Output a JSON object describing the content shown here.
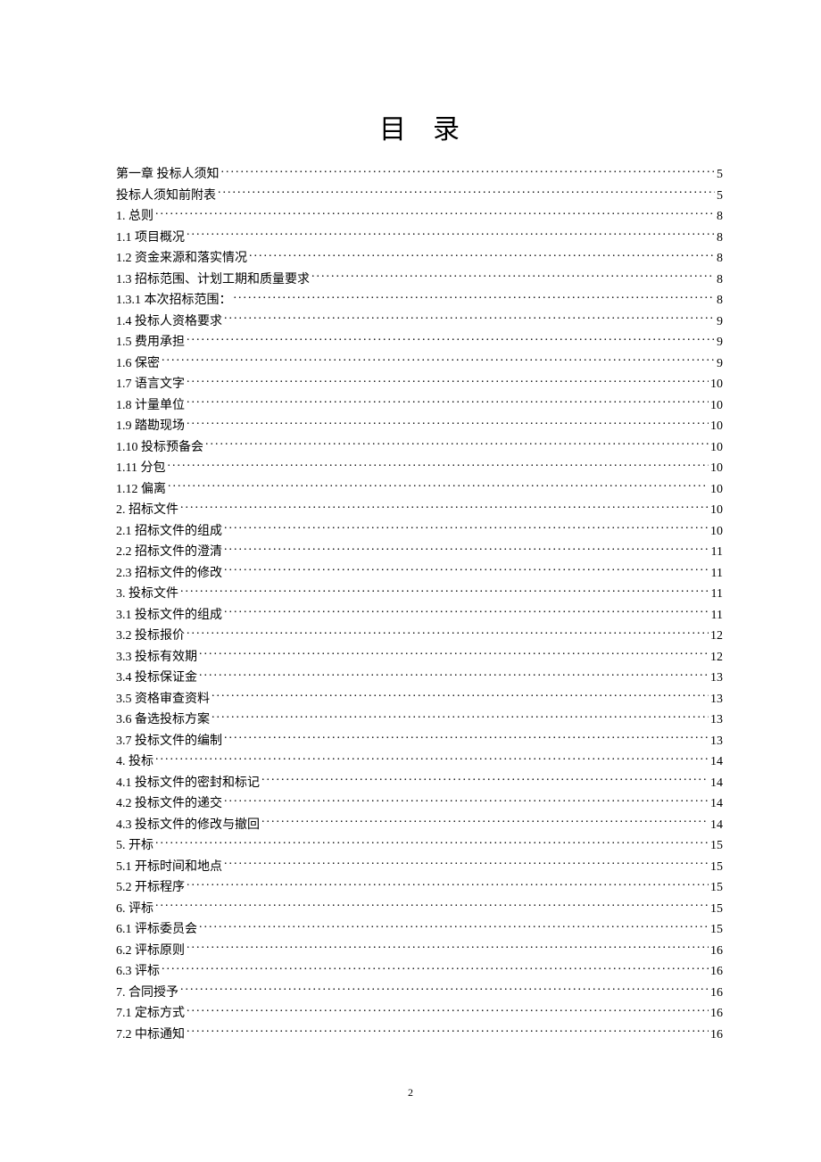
{
  "title": "目录",
  "page_number": "2",
  "toc": [
    {
      "label": "第一章   投标人须知",
      "page": "5"
    },
    {
      "label": "投标人须知前附表",
      "page": "5"
    },
    {
      "label": "1. 总则",
      "page": "8"
    },
    {
      "label": "1.1 项目概况",
      "page": "8"
    },
    {
      "label": "1.2 资金来源和落实情况",
      "page": "8"
    },
    {
      "label": "1.3 招标范围、计划工期和质量要求",
      "page": "8"
    },
    {
      "label": "1.3.1 本次招标范围：",
      "page": "8"
    },
    {
      "label": "1.4 投标人资格要求",
      "page": "9"
    },
    {
      "label": "1.5 费用承担",
      "page": "9"
    },
    {
      "label": "1.6 保密",
      "page": "9"
    },
    {
      "label": "1.7 语言文字",
      "page": "10"
    },
    {
      "label": "1.8 计量单位",
      "page": "10"
    },
    {
      "label": "1.9 踏勘现场",
      "page": "10"
    },
    {
      "label": "1.10 投标预备会",
      "page": "10"
    },
    {
      "label": "1.11 分包",
      "page": "10"
    },
    {
      "label": "1.12 偏离",
      "page": "10"
    },
    {
      "label": "2. 招标文件",
      "page": "10"
    },
    {
      "label": "2.1 招标文件的组成",
      "page": "10"
    },
    {
      "label": "2.2 招标文件的澄清",
      "page": "11"
    },
    {
      "label": "2.3 招标文件的修改",
      "page": "11"
    },
    {
      "label": "3. 投标文件",
      "page": "11"
    },
    {
      "label": "3.1 投标文件的组成",
      "page": "11"
    },
    {
      "label": "3.2 投标报价",
      "page": "12"
    },
    {
      "label": "3.3 投标有效期",
      "page": "12"
    },
    {
      "label": "3.4 投标保证金",
      "page": "13"
    },
    {
      "label": "3.5 资格审查资料",
      "page": "13"
    },
    {
      "label": "3.6 备选投标方案",
      "page": "13"
    },
    {
      "label": "3.7 投标文件的编制",
      "page": "13"
    },
    {
      "label": "4. 投标",
      "page": "14"
    },
    {
      "label": "4.1 投标文件的密封和标记",
      "page": "14"
    },
    {
      "label": "4.2 投标文件的递交",
      "page": "14"
    },
    {
      "label": "4.3 投标文件的修改与撤回",
      "page": "14"
    },
    {
      "label": "5. 开标",
      "page": "15"
    },
    {
      "label": "5.1 开标时间和地点",
      "page": "15"
    },
    {
      "label": "5.2 开标程序",
      "page": "15"
    },
    {
      "label": "6. 评标",
      "page": "15"
    },
    {
      "label": "6.1 评标委员会",
      "page": "15"
    },
    {
      "label": "6.2 评标原则",
      "page": "16"
    },
    {
      "label": "6.3 评标",
      "page": "16"
    },
    {
      "label": "7. 合同授予",
      "page": "16"
    },
    {
      "label": "7.1 定标方式",
      "page": "16"
    },
    {
      "label": "7.2 中标通知",
      "page": "16"
    }
  ]
}
